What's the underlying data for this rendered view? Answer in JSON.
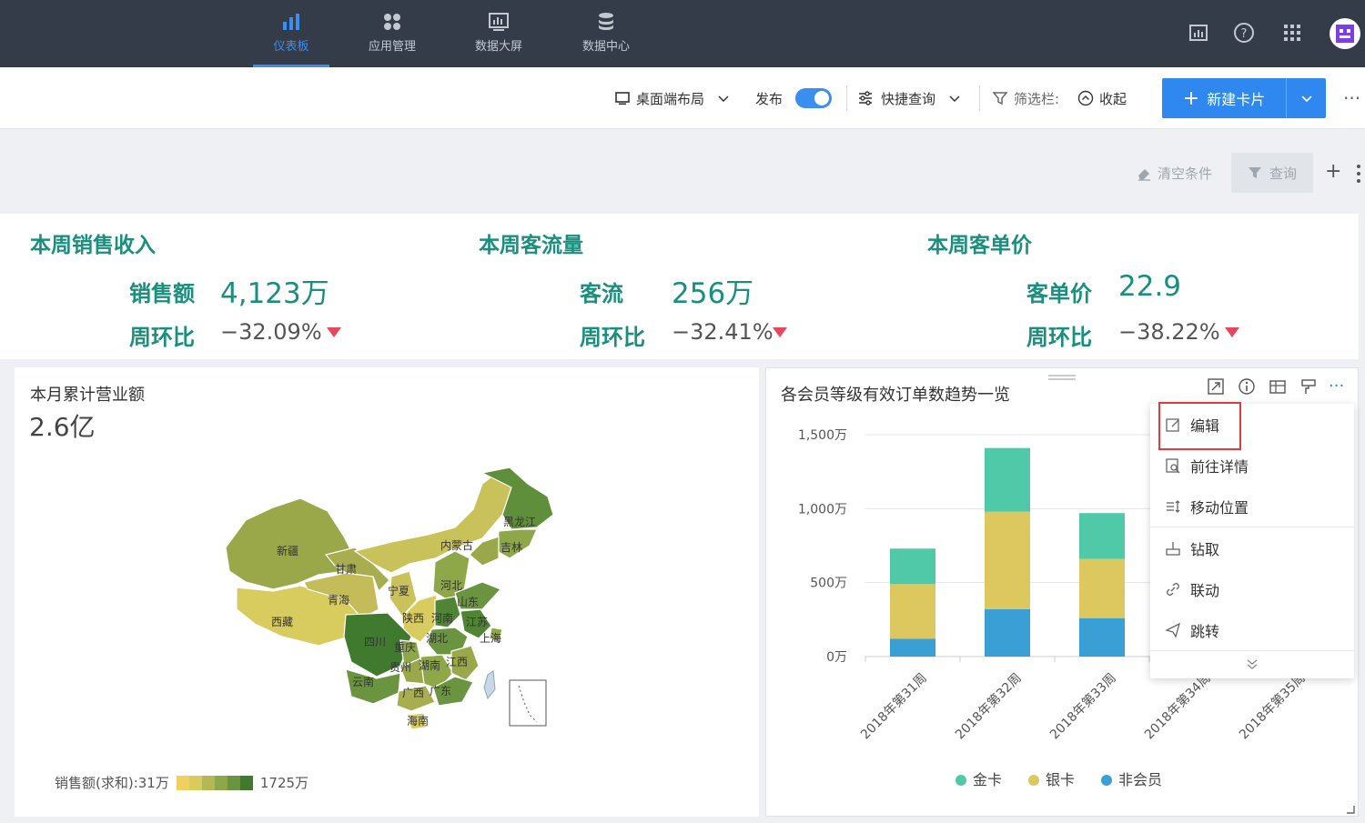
{
  "nav": [
    {
      "label": "仪表板",
      "active": true
    },
    {
      "label": "应用管理"
    },
    {
      "label": "数据大屏"
    },
    {
      "label": "数据中心"
    }
  ],
  "toolbar": {
    "layout_label": "桌面端布局",
    "publish_label": "发布",
    "quick_query_label": "快捷查询",
    "filter_bar_label": "筛选栏:",
    "collapse_label": "收起",
    "new_card_label": "新建卡片"
  },
  "filter": {
    "clear_label": "清空条件",
    "query_label": "查询"
  },
  "kpis": [
    {
      "title": "本周销售收入",
      "label": "销售额",
      "value": "4,123万",
      "change_label": "周环比",
      "change": "−32.09%"
    },
    {
      "title": "本周客流量",
      "label": "客流",
      "value": "256万",
      "change_label": "周环比",
      "change": "−32.41%"
    },
    {
      "title": "本周客单价",
      "label": "客单价",
      "value": "22.9",
      "change_label": "周环比",
      "change": "−38.22%"
    }
  ],
  "map_card": {
    "title": "本月累计营业额",
    "total": "2.6亿",
    "legend_label": "销售额(求和):31万",
    "legend_max": "1725万",
    "legend_colors": [
      "#f0d060",
      "#d8cc5e",
      "#b5b955",
      "#8ea748",
      "#6a943f",
      "#3f7a2e"
    ],
    "provinces": [
      "黑龙江",
      "吉林",
      "内蒙古",
      "新疆",
      "甘肃",
      "河北",
      "山东",
      "宁夏",
      "青海",
      "陕西",
      "河南",
      "江苏",
      "西藏",
      "四川",
      "湖北",
      "上海",
      "重庆",
      "贵州",
      "湖南",
      "江西",
      "云南",
      "广西",
      "广东",
      "海南"
    ]
  },
  "chart_data": {
    "type": "bar",
    "stacked": true,
    "title": "各会员等级有效订单数趋势一览",
    "categories": [
      "2018年第31周",
      "2018年第32周",
      "2018年第33周",
      "2018年第34周",
      "2018年第35周"
    ],
    "series": [
      {
        "name": "非会员",
        "color": "#3a9fd4",
        "values": [
          120,
          320,
          260,
          null,
          null
        ]
      },
      {
        "name": "银卡",
        "color": "#dcc85e",
        "values": [
          370,
          660,
          400,
          null,
          null
        ]
      },
      {
        "name": "金卡",
        "color": "#4fc9a8",
        "values": [
          240,
          430,
          310,
          null,
          null
        ]
      }
    ],
    "y_ticks": [
      "0万",
      "500万",
      "1,000万",
      "1,500万"
    ],
    "ylim": [
      0,
      1500
    ],
    "y_unit": "万",
    "legend_position": "bottom"
  },
  "menu": {
    "items": [
      "编辑",
      "前往详情",
      "移动位置",
      "钻取",
      "联动",
      "跳转"
    ]
  }
}
